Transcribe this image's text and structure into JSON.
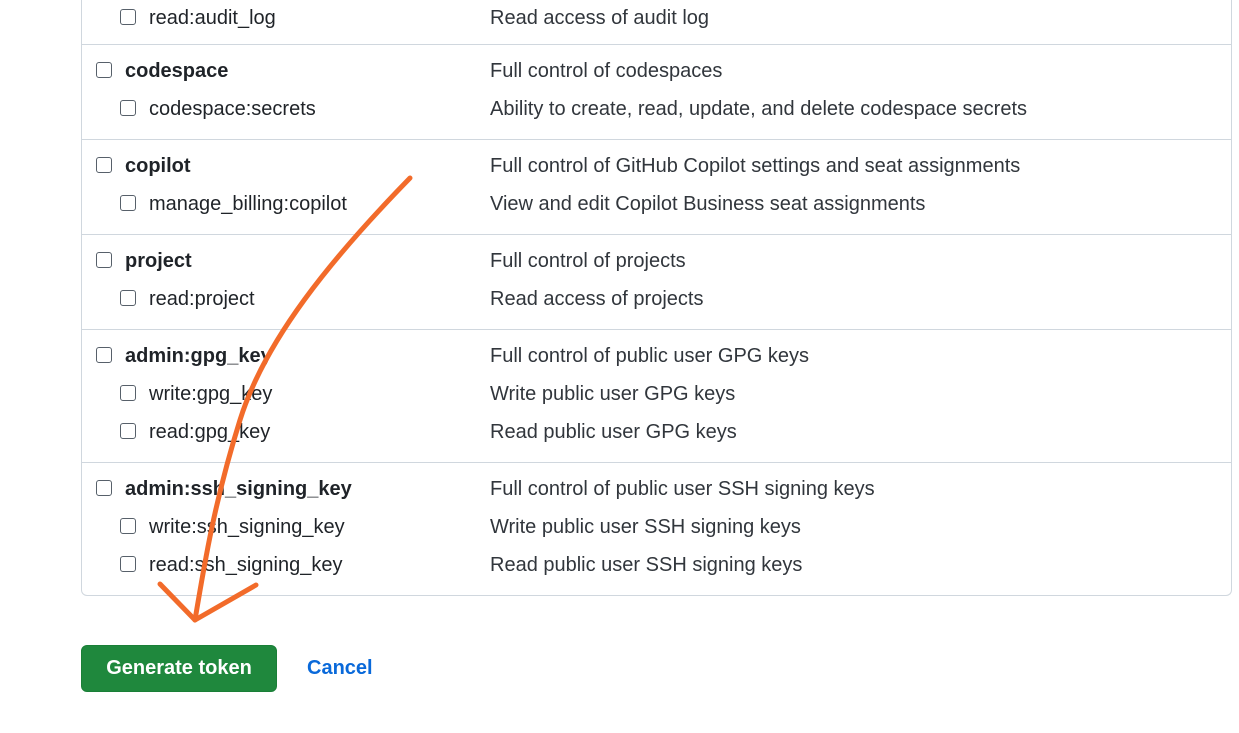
{
  "scope_groups": [
    {
      "rows": [
        {
          "type": "child",
          "name": "read:audit_log",
          "description": "Read access of audit log"
        }
      ]
    },
    {
      "rows": [
        {
          "type": "parent",
          "name": "codespace",
          "description": "Full control of codespaces"
        },
        {
          "type": "child",
          "name": "codespace:secrets",
          "description": "Ability to create, read, update, and delete codespace secrets"
        }
      ]
    },
    {
      "rows": [
        {
          "type": "parent",
          "name": "copilot",
          "description": "Full control of GitHub Copilot settings and seat assignments"
        },
        {
          "type": "child",
          "name": "manage_billing:copilot",
          "description": "View and edit Copilot Business seat assignments"
        }
      ]
    },
    {
      "rows": [
        {
          "type": "parent",
          "name": "project",
          "description": "Full control of projects"
        },
        {
          "type": "child",
          "name": "read:project",
          "description": "Read access of projects"
        }
      ]
    },
    {
      "rows": [
        {
          "type": "parent",
          "name": "admin:gpg_key",
          "description": "Full control of public user GPG keys"
        },
        {
          "type": "child",
          "name": "write:gpg_key",
          "description": "Write public user GPG keys"
        },
        {
          "type": "child",
          "name": "read:gpg_key",
          "description": "Read public user GPG keys"
        }
      ]
    },
    {
      "rows": [
        {
          "type": "parent",
          "name": "admin:ssh_signing_key",
          "description": "Full control of public user SSH signing keys"
        },
        {
          "type": "child",
          "name": "write:ssh_signing_key",
          "description": "Write public user SSH signing keys"
        },
        {
          "type": "child",
          "name": "read:ssh_signing_key",
          "description": "Read public user SSH signing keys"
        }
      ]
    }
  ],
  "actions": {
    "generate_label": "Generate token",
    "cancel_label": "Cancel"
  },
  "colors": {
    "primary_button": "#1f883d",
    "link": "#0969da",
    "annotation_arrow": "#f26b2a",
    "border": "#d0d7de"
  }
}
